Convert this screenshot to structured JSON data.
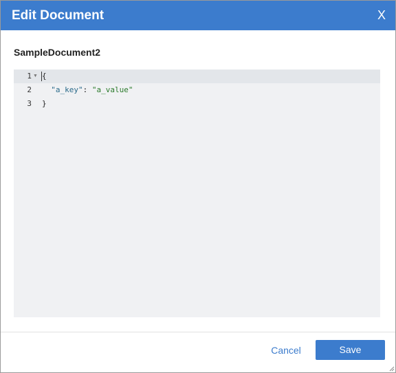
{
  "dialog": {
    "title": "Edit Document",
    "close_label": "X",
    "document_name": "SampleDocument2"
  },
  "editor": {
    "line_numbers": [
      "1",
      "2",
      "3"
    ],
    "fold_icon": "fold-arrow-down",
    "lines": [
      {
        "text": "{"
      },
      {
        "indent": "  ",
        "key": "\"a_key\"",
        "sep": ": ",
        "value": "\"a_value\""
      },
      {
        "text": "}"
      }
    ]
  },
  "footer": {
    "cancel_label": "Cancel",
    "save_label": "Save"
  },
  "colors": {
    "accent": "#3c7ccd",
    "editor_bg": "#f0f1f3",
    "json_key": "#2a6a8a",
    "json_string": "#2a7a2a"
  }
}
